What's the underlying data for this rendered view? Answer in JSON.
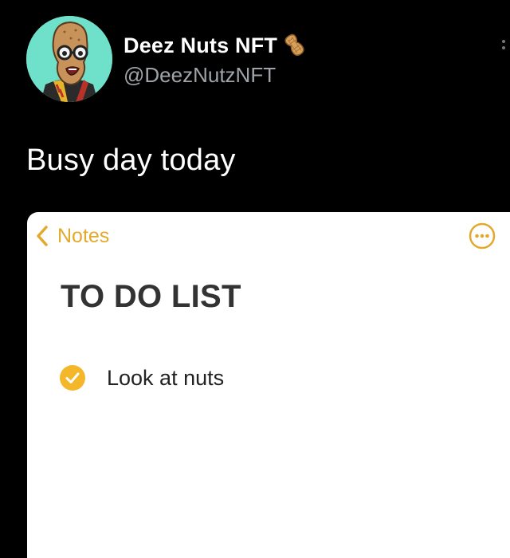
{
  "tweet": {
    "display_name": "Deez Nuts NFT",
    "handle": "@DeezNutzNFT",
    "text": "Busy day today",
    "verified_badge_icon": "peanut-icon",
    "menu_icon": "more-vertical-icon"
  },
  "notes": {
    "back_label": "Notes",
    "back_icon": "chevron-left-icon",
    "more_icon": "more-circle-icon",
    "title": "TO DO LIST",
    "items": [
      {
        "label": "Look at nuts",
        "checked": true
      }
    ]
  },
  "colors": {
    "background": "#000000",
    "avatar_background": "#6fe0c9",
    "notes_accent": "#e3a92b",
    "checkbox_fill": "#f4b72a"
  }
}
